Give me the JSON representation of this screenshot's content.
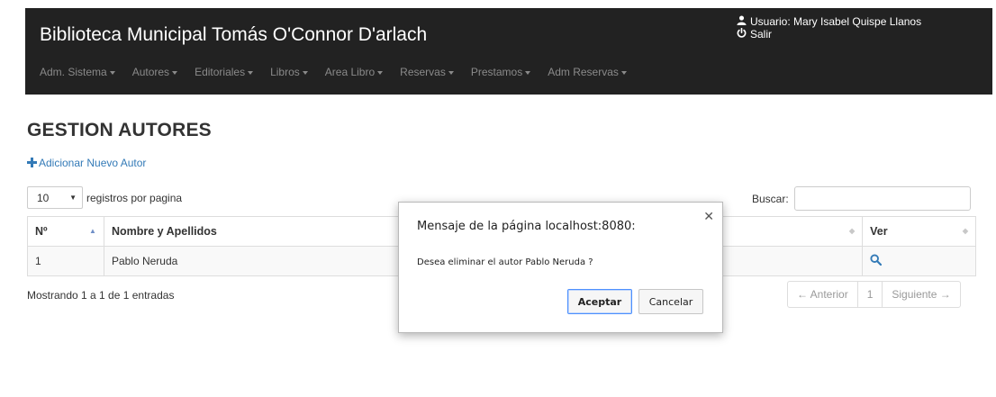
{
  "header": {
    "brand": "Biblioteca Municipal Tomás O'Connor D'arlach",
    "user_label": "Usuario: Mary Isabel Quispe Llanos",
    "logout_label": "Salir",
    "menu": [
      "Adm. Sistema",
      "Autores",
      "Editoriales",
      "Libros",
      "Area Libro",
      "Reservas",
      "Prestamos",
      "Adm Reservas"
    ]
  },
  "main": {
    "title": "GESTION AUTORES",
    "add_link": "Adicionar Nuevo Autor",
    "length_value": "10",
    "length_suffix": "registros por pagina",
    "search_label": "Buscar:",
    "search_value": ""
  },
  "table": {
    "columns": [
      "Nº",
      "Nombre y Apellidos",
      "Ver"
    ],
    "rows": [
      {
        "num": "1",
        "name": "Pablo Neruda"
      }
    ]
  },
  "footer": {
    "info": "Mostrando 1 a 1 de 1 entradas",
    "prev": "← Anterior",
    "page": "1",
    "next": "Siguiente →"
  },
  "dialog": {
    "title": "Mensaje de la página localhost:8080:",
    "message": "Desea eliminar el autor Pablo Neruda ?",
    "ok": "Aceptar",
    "cancel": "Cancelar"
  },
  "colors": {
    "navbar": "#222222",
    "link": "#337ab7"
  },
  "icons": {
    "user": "user-icon",
    "power": "power-icon",
    "plus": "plus-icon",
    "search": "search-icon",
    "close": "close-icon"
  }
}
